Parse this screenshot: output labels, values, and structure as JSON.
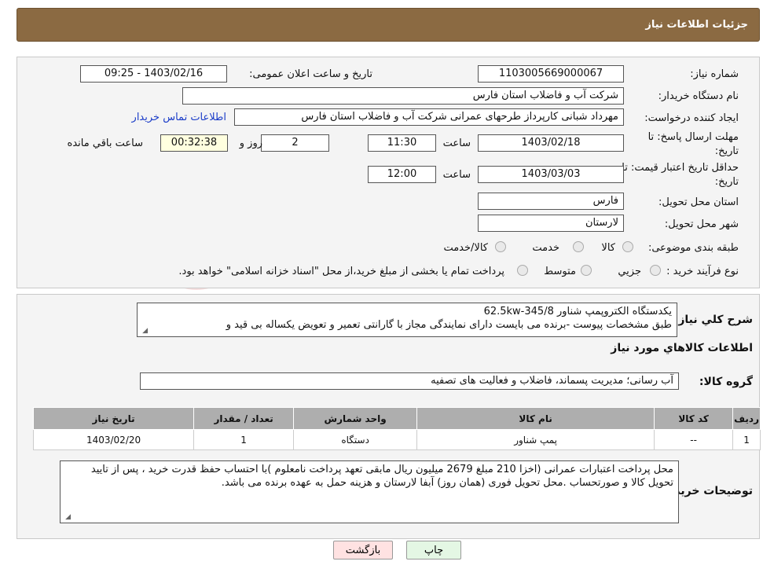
{
  "header": {
    "title": "جزئیات اطلاعات نیاز"
  },
  "fields": {
    "need_number_label": "شماره نیاز:",
    "need_number": "1103005669000067",
    "announce_label": "تاریخ و ساعت اعلان عمومی:",
    "announce_value": "1403/02/16 - 09:25",
    "buyer_org_label": "نام دستگاه خریدار:",
    "buyer_org": "شرکت آب و فاضلاب استان فارس",
    "creator_label": "ایجاد کننده درخواست:",
    "creator": "مهرداد شبانی کارپرداز طرحهای عمرانی  شرکت آب و فاضلاب استان فارس",
    "contact_link": "اطلاعات تماس خریدار",
    "deadline_label_1": "مهلت ارسال پاسخ: تا",
    "deadline_label_2": "تاریخ:",
    "deadline_date": "1403/02/18",
    "time_label": "ساعت",
    "deadline_time": "11:30",
    "days_value": "2",
    "days_label": "روز و",
    "remaining_time": "00:32:38",
    "remaining_label": "ساعت باقي مانده",
    "validity_label_1": "حداقل تاریخ اعتبار قیمت: تا",
    "validity_label_2": "تاریخ:",
    "validity_date": "1403/03/03",
    "validity_time": "12:00",
    "province_label": "استان محل تحویل:",
    "province": "فارس",
    "city_label": "شهر محل تحویل:",
    "city": "لارستان",
    "category_label": "طبقه بندی موضوعی:",
    "category_options": [
      "کالا",
      "خدمت",
      "کالا/خدمت"
    ],
    "purchase_type_label": "نوع فرآیند خرید :",
    "purchase_options": [
      "جزیي",
      "متوسط"
    ],
    "purchase_note": "پرداخت تمام یا بخشی از مبلغ خرید،از محل \"اسناد خزانه اسلامی\" خواهد بود."
  },
  "summary": {
    "label": "شرح كلي نياز:",
    "line1": "یکدستگاه الکتروپمپ شناور 345/8-62.5kw",
    "line2": "طبق مشخصات پیوست -برنده می بایست دارای نمایندگی مجاز با گارانتی تعمیر و تعویض یکساله بی قید و"
  },
  "goods_section_title": "اطلاعات كالاهاي مورد نياز",
  "goods_group": {
    "label": "گروه کالا:",
    "value": "آب رسانی؛ مدیریت پسماند، فاضلاب و فعالیت های تصفیه"
  },
  "table": {
    "headers": [
      "ردیف",
      "کد کالا",
      "نام کالا",
      "واحد شمارش",
      "تعداد / مقدار",
      "تاریخ نیاز"
    ],
    "rows": [
      [
        "1",
        "--",
        "پمپ شناور",
        "دستگاه",
        "1",
        "1403/02/20"
      ]
    ]
  },
  "buyer_notes": {
    "label": "توضیحات خریدار:",
    "text": "محل پرداخت اعتبارات عمرانی (اخزا 210 مبلغ 2679 میلیون ریال مابقی تعهد پرداخت نامعلوم )با احتساب حفظ قدرت خرید ، پس از تایید تحویل کالا و صورتحساب .محل تحویل فوری (همان روز) آبفا لارستان و هزینه حمل به عهده برنده می باشد."
  },
  "buttons": {
    "print": "چاپ",
    "back": "بازگشت"
  },
  "colors": {
    "header_bg": "#8b6a42",
    "link": "#1a3cc8",
    "back_button": "#ffe0e0",
    "print_button": "#e0ffe0"
  }
}
